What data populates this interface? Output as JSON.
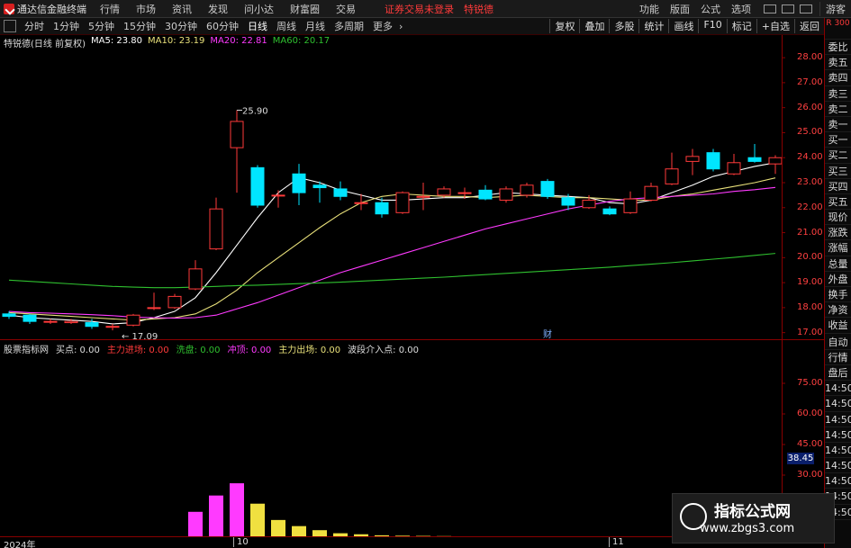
{
  "app": {
    "title": "通达信金融终端",
    "menu": [
      "行情",
      "市场",
      "资讯",
      "发现",
      "问小达",
      "财富圈",
      "交易"
    ],
    "warning": "证券交易未登录",
    "stock_short": "特锐德",
    "right_menu": [
      "功能",
      "版面",
      "公式",
      "选项"
    ],
    "guest": "游客"
  },
  "toolbar": {
    "periods": [
      "分时",
      "1分钟",
      "5分钟",
      "15分钟",
      "30分钟",
      "60分钟",
      "日线",
      "周线",
      "月线",
      "多周期",
      "更多"
    ],
    "active_period": "日线",
    "right_buttons": [
      "复权",
      "叠加",
      "多股",
      "统计",
      "画线",
      "F10",
      "标记",
      "+自选",
      "返回"
    ]
  },
  "side_panel": {
    "top_label": "R 300",
    "tabs_main": [
      "委比",
      "卖五",
      "卖四",
      "卖三",
      "卖二",
      "卖一",
      "买一",
      "买二",
      "买三",
      "买四",
      "买五",
      "现价",
      "涨跌",
      "涨幅",
      "总量",
      "外盘",
      "换手",
      "净资",
      "收益"
    ],
    "tabs_sub": [
      "自动",
      "行情",
      "盘后",
      "14:50",
      "14:50",
      "14:50",
      "14:50",
      "14:50",
      "14:50",
      "14:50",
      "14:50",
      "14:50"
    ]
  },
  "main_legend": {
    "name": "特锐德(日线 前复权)",
    "ma5": "MA5: 23.80",
    "ma10": "MA10: 23.19",
    "ma20": "MA20: 22.81",
    "ma60": "MA60: 20.17"
  },
  "indicator_legend": {
    "name": "股票指标网",
    "buy": "买点: 0.00",
    "main_in": "主力进场: 0.00",
    "wash": "洗盘: 0.00",
    "cost": "冲顶: 0.00",
    "main_out": "主力出场: 0.00",
    "band": "波段介入点: 0.00"
  },
  "annotations": {
    "high": "25.90",
    "low": "17.09",
    "fin_marker": "财",
    "sub_current": "38.45"
  },
  "dates": {
    "start": "2024年",
    "m10": "10",
    "m11": "11"
  },
  "watermark": {
    "title": "指标公式网",
    "url": "www.zbgs3.com"
  },
  "colors": {
    "up": "#ff3a3a",
    "down": "#00e5ff",
    "ma5": "#ffffff",
    "ma10": "#e8e07a",
    "ma20": "#ff3aff",
    "ma60": "#2fc02f",
    "grid": "#880000"
  },
  "chart_data": [
    {
      "type": "candlestick",
      "title": "特锐德(日线 前复权)",
      "ylim": [
        16.7,
        28.4
      ],
      "yticks": [
        17.0,
        18.0,
        19.0,
        20.0,
        21.0,
        22.0,
        23.0,
        24.0,
        25.0,
        26.0,
        27.0,
        28.0
      ],
      "candles": [
        {
          "o": 17.75,
          "h": 17.85,
          "l": 17.55,
          "c": 17.65
        },
        {
          "o": 17.7,
          "h": 17.75,
          "l": 17.35,
          "c": 17.45
        },
        {
          "o": 17.45,
          "h": 17.55,
          "l": 17.35,
          "c": 17.45
        },
        {
          "o": 17.4,
          "h": 17.55,
          "l": 17.35,
          "c": 17.45
        },
        {
          "o": 17.4,
          "h": 17.55,
          "l": 17.15,
          "c": 17.25
        },
        {
          "o": 17.25,
          "h": 17.35,
          "l": 17.09,
          "c": 17.25
        },
        {
          "o": 17.3,
          "h": 17.75,
          "l": 17.25,
          "c": 17.7
        },
        {
          "o": 18.0,
          "h": 18.6,
          "l": 17.9,
          "c": 18.0
        },
        {
          "o": 18.0,
          "h": 18.55,
          "l": 17.95,
          "c": 18.45
        },
        {
          "o": 18.75,
          "h": 19.9,
          "l": 18.7,
          "c": 19.55
        },
        {
          "o": 20.35,
          "h": 22.4,
          "l": 20.3,
          "c": 21.95
        },
        {
          "o": 24.4,
          "h": 25.9,
          "l": 22.6,
          "c": 25.45
        },
        {
          "o": 23.6,
          "h": 23.7,
          "l": 22.0,
          "c": 22.1
        },
        {
          "o": 22.5,
          "h": 22.7,
          "l": 22.0,
          "c": 22.5
        },
        {
          "o": 23.35,
          "h": 23.75,
          "l": 22.1,
          "c": 22.6
        },
        {
          "o": 22.9,
          "h": 23.05,
          "l": 22.2,
          "c": 22.8
        },
        {
          "o": 22.75,
          "h": 23.05,
          "l": 22.3,
          "c": 22.45
        },
        {
          "o": 22.2,
          "h": 22.55,
          "l": 21.9,
          "c": 22.2
        },
        {
          "o": 22.2,
          "h": 22.4,
          "l": 21.6,
          "c": 21.75
        },
        {
          "o": 21.8,
          "h": 22.65,
          "l": 21.75,
          "c": 22.6
        },
        {
          "o": 22.45,
          "h": 23.0,
          "l": 21.9,
          "c": 22.45
        },
        {
          "o": 22.5,
          "h": 22.85,
          "l": 22.4,
          "c": 22.75
        },
        {
          "o": 22.6,
          "h": 22.8,
          "l": 22.35,
          "c": 22.6
        },
        {
          "o": 22.7,
          "h": 22.9,
          "l": 22.3,
          "c": 22.35
        },
        {
          "o": 22.3,
          "h": 22.85,
          "l": 22.2,
          "c": 22.75
        },
        {
          "o": 22.5,
          "h": 23.0,
          "l": 22.4,
          "c": 22.9
        },
        {
          "o": 23.05,
          "h": 23.15,
          "l": 22.35,
          "c": 22.45
        },
        {
          "o": 22.4,
          "h": 22.55,
          "l": 21.9,
          "c": 22.1
        },
        {
          "o": 22.0,
          "h": 22.5,
          "l": 21.95,
          "c": 22.3
        },
        {
          "o": 21.95,
          "h": 22.05,
          "l": 21.7,
          "c": 21.75
        },
        {
          "o": 21.8,
          "h": 22.65,
          "l": 21.75,
          "c": 22.35
        },
        {
          "o": 22.3,
          "h": 23.0,
          "l": 22.25,
          "c": 22.85
        },
        {
          "o": 22.95,
          "h": 24.2,
          "l": 22.9,
          "c": 23.55
        },
        {
          "o": 23.85,
          "h": 24.35,
          "l": 23.3,
          "c": 24.05
        },
        {
          "o": 24.2,
          "h": 24.35,
          "l": 23.45,
          "c": 23.55
        },
        {
          "o": 23.35,
          "h": 24.15,
          "l": 23.3,
          "c": 23.8
        },
        {
          "o": 24.0,
          "h": 24.55,
          "l": 23.8,
          "c": 23.85
        },
        {
          "o": 23.75,
          "h": 24.1,
          "l": 23.35,
          "c": 24.0
        }
      ],
      "ma_series": [
        {
          "name": "MA5",
          "values": [
            17.7,
            17.6,
            17.55,
            17.5,
            17.45,
            17.35,
            17.4,
            17.6,
            17.85,
            18.4,
            19.4,
            20.5,
            21.6,
            22.6,
            23.2,
            23.0,
            22.7,
            22.5,
            22.3,
            22.3,
            22.35,
            22.4,
            22.4,
            22.5,
            22.6,
            22.55,
            22.5,
            22.45,
            22.4,
            22.2,
            22.15,
            22.3,
            22.6,
            22.9,
            23.25,
            23.45,
            23.65,
            23.8
          ]
        },
        {
          "name": "MA10",
          "values": [
            17.8,
            17.75,
            17.7,
            17.65,
            17.6,
            17.55,
            17.5,
            17.55,
            17.6,
            17.75,
            18.15,
            18.7,
            19.4,
            20.0,
            20.6,
            21.2,
            21.75,
            22.2,
            22.45,
            22.55,
            22.5,
            22.45,
            22.45,
            22.4,
            22.45,
            22.5,
            22.45,
            22.4,
            22.4,
            22.35,
            22.3,
            22.3,
            22.45,
            22.55,
            22.7,
            22.85,
            23.0,
            23.19
          ]
        },
        {
          "name": "MA20",
          "values": [
            17.85,
            17.8,
            17.78,
            17.75,
            17.72,
            17.68,
            17.62,
            17.6,
            17.58,
            17.6,
            17.7,
            17.95,
            18.2,
            18.5,
            18.8,
            19.1,
            19.4,
            19.65,
            19.9,
            20.15,
            20.4,
            20.65,
            20.9,
            21.15,
            21.35,
            21.55,
            21.75,
            21.95,
            22.1,
            22.25,
            22.35,
            22.4,
            22.45,
            22.5,
            22.55,
            22.65,
            22.72,
            22.81
          ]
        },
        {
          "name": "MA60",
          "values": [
            19.1,
            19.05,
            19.0,
            18.95,
            18.9,
            18.85,
            18.82,
            18.8,
            18.8,
            18.82,
            18.85,
            18.88,
            18.9,
            18.93,
            18.96,
            18.99,
            19.02,
            19.06,
            19.1,
            19.14,
            19.18,
            19.22,
            19.27,
            19.32,
            19.37,
            19.42,
            19.47,
            19.52,
            19.57,
            19.62,
            19.68,
            19.74,
            19.8,
            19.87,
            19.94,
            20.01,
            20.09,
            20.17
          ]
        }
      ]
    },
    {
      "type": "bar",
      "title": "股票指标网",
      "ylim": [
        0,
        90
      ],
      "yticks": [
        30.0,
        45.0,
        60.0,
        75.0
      ],
      "current_value": 38.45,
      "values": [
        0,
        0,
        0,
        0,
        0,
        0,
        0,
        0,
        0,
        12,
        20,
        26,
        16,
        8,
        5,
        3,
        1.5,
        1,
        0.5,
        0.3,
        0.2,
        0.1,
        0,
        0,
        0,
        0,
        0,
        0,
        0,
        0,
        0,
        0,
        0,
        0,
        0,
        0,
        0,
        0
      ],
      "bar_colors": [
        "magenta",
        "magenta",
        "magenta",
        "yellow",
        "yellow",
        "yellow",
        "yellow",
        "yellow",
        "yellow",
        "yellow",
        "yellow",
        "yellow",
        "yellow"
      ]
    }
  ]
}
